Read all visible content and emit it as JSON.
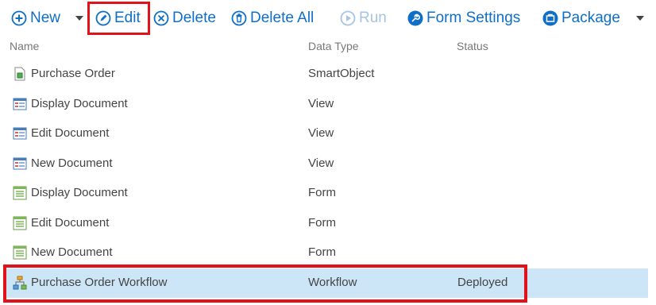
{
  "toolbar": {
    "new_label": "New",
    "edit_label": "Edit",
    "delete_label": "Delete",
    "delete_all_label": "Delete All",
    "run_label": "Run",
    "form_settings_label": "Form Settings",
    "package_label": "Package"
  },
  "columns": {
    "name": "Name",
    "data_type": "Data Type",
    "status": "Status"
  },
  "rows": [
    {
      "name": "Purchase Order",
      "type": "SmartObject",
      "status": "",
      "icon": "smartobject-icon"
    },
    {
      "name": "Display Document",
      "type": "View",
      "status": "",
      "icon": "view-icon"
    },
    {
      "name": "Edit Document",
      "type": "View",
      "status": "",
      "icon": "view-icon"
    },
    {
      "name": "New Document",
      "type": "View",
      "status": "",
      "icon": "view-icon"
    },
    {
      "name": "Display Document",
      "type": "Form",
      "status": "",
      "icon": "form-icon"
    },
    {
      "name": "Edit Document",
      "type": "Form",
      "status": "",
      "icon": "form-icon"
    },
    {
      "name": "New Document",
      "type": "Form",
      "status": "",
      "icon": "form-icon"
    },
    {
      "name": "Purchase Order Workflow",
      "type": "Workflow",
      "status": "Deployed",
      "icon": "workflow-icon",
      "selected": true
    }
  ],
  "colors": {
    "accent": "#0f6fc6",
    "disabled": "#a7c4e2",
    "selection": "#cde6f7",
    "highlight": "#e0131b"
  }
}
